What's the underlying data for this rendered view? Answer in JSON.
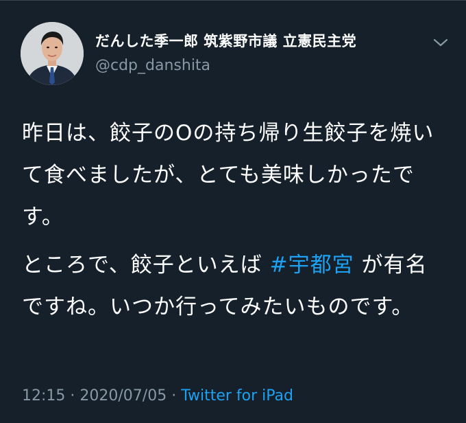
{
  "user": {
    "display_name": "だんした季一郎 筑紫野市議 立憲民主党",
    "handle": "@cdp_danshita"
  },
  "icons": {
    "menu": "chevron-down-icon",
    "avatar": "profile-photo"
  },
  "tweet": {
    "para1": "昨日は、餃子のOの持ち帰り生餃子を焼いて食べましたが、とても美味しかったです。",
    "para2_before": "ところで、餃子といえば ",
    "hashtag": "#宇都宮",
    "para2_after": " が有名ですね。いつか行ってみたいものです。"
  },
  "meta": {
    "time": "12:15",
    "separator1": " · ",
    "date": "2020/07/05",
    "separator2": " · ",
    "source": "Twitter for iPad"
  },
  "colors": {
    "background": "#15202b",
    "text": "#ffffff",
    "secondary": "#8899a6",
    "link": "#1da1f2"
  }
}
